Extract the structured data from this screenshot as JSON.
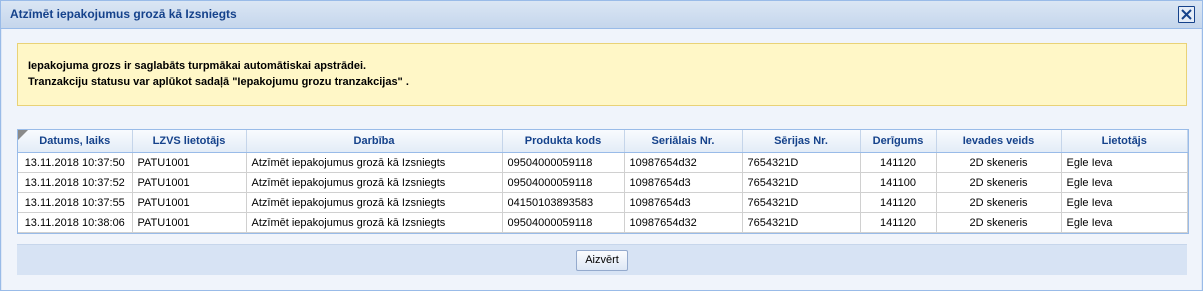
{
  "window": {
    "title": "Atzīmēt iepakojumus grozā kā Izsniegts"
  },
  "notice": {
    "line1": "Iepakojuma grozs ir saglabāts turpmākai automātiskai apstrādei.",
    "line2": "Tranzakciju statusu var aplūkot sadaļā \"Iepakojumu grozu tranzakcijas\" ."
  },
  "grid": {
    "columns": [
      "Datums, laiks",
      "LZVS lietotājs",
      "Darbība",
      "Produkta kods",
      "Seriālais Nr.",
      "Sērijas Nr.",
      "Derīgums",
      "Ievades veids",
      "Lietotājs"
    ],
    "rows": [
      [
        "13.11.2018 10:37:50",
        "PATU1001",
        "Atzīmēt iepakojumus grozā kā Izsniegts",
        "09504000059118",
        "10987654d32",
        "7654321D",
        "141120",
        "2D skeneris",
        "Egle Ieva"
      ],
      [
        "13.11.2018 10:37:52",
        "PATU1001",
        "Atzīmēt iepakojumus grozā kā Izsniegts",
        "09504000059118",
        "10987654d3",
        "7654321D",
        "141100",
        "2D skeneris",
        "Egle Ieva"
      ],
      [
        "13.11.2018 10:37:55",
        "PATU1001",
        "Atzīmēt iepakojumus grozā kā Izsniegts",
        "04150103893583",
        "10987654d3",
        "7654321D",
        "141120",
        "2D skeneris",
        "Egle Ieva"
      ],
      [
        "13.11.2018 10:38:06",
        "PATU1001",
        "Atzīmēt iepakojumus grozā kā Izsniegts",
        "09504000059118",
        "10987654d32",
        "7654321D",
        "141120",
        "2D skeneris",
        "Egle Ieva"
      ]
    ]
  },
  "footer": {
    "close_label": "Aizvērt"
  },
  "icons": {
    "close": "close-icon",
    "sort_corner": "sort-corner-icon"
  },
  "colors": {
    "title": "#15428b",
    "notice_bg": "#fff7c7",
    "notice_border": "#e9d277",
    "panel": "#dfe8f6"
  }
}
